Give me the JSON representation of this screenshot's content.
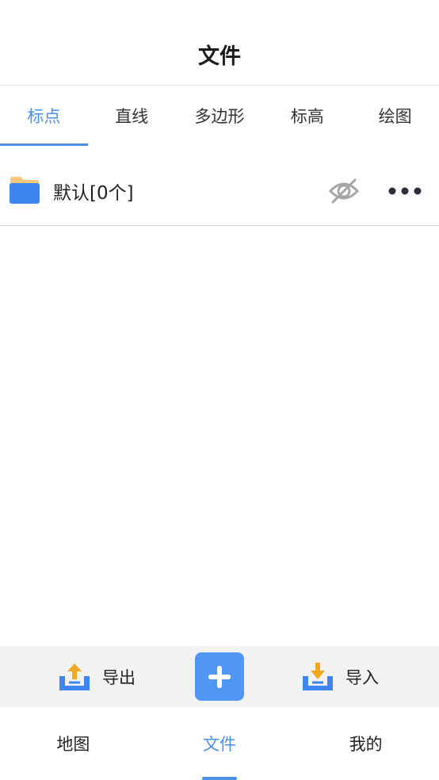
{
  "header": {
    "title": "文件"
  },
  "tabs": [
    {
      "label": "标点",
      "active": true
    },
    {
      "label": "直线",
      "active": false
    },
    {
      "label": "多边形",
      "active": false
    },
    {
      "label": "标高",
      "active": false
    },
    {
      "label": "绘图",
      "active": false
    }
  ],
  "folder": {
    "name": "默认[0个]",
    "icon": "folder-icon",
    "visibility_icon": "eye-off-icon",
    "menu_icon": "more-icon"
  },
  "actions": {
    "export_label": "导出",
    "import_label": "导入",
    "add_icon": "plus-icon"
  },
  "bottom_nav": [
    {
      "label": "地图",
      "active": false
    },
    {
      "label": "文件",
      "active": true
    },
    {
      "label": "我的",
      "active": false
    }
  ],
  "colors": {
    "accent": "#4a8fe8",
    "button_blue": "#4f97f3",
    "orange": "#f5a623",
    "folder_back": "#f7c77a",
    "folder_front": "#3d86f0"
  }
}
